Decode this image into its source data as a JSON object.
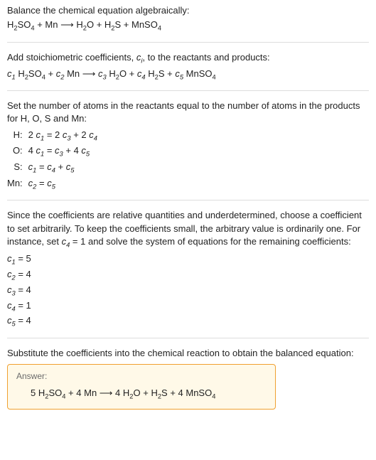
{
  "intro": {
    "line1": "Balance the chemical equation algebraically:"
  },
  "unbalanced": {
    "r1a": "H",
    "r1b": "2",
    "r1c": "SO",
    "r1d": "4",
    "plus1": " + ",
    "r2": "Mn",
    "arrow": " ⟶ ",
    "p1a": "H",
    "p1b": "2",
    "p1c": "O",
    "plus2": " + ",
    "p2a": "H",
    "p2b": "2",
    "p2c": "S",
    "plus3": " + ",
    "p3a": "MnSO",
    "p3b": "4"
  },
  "stoich_intro": {
    "t1": "Add stoichiometric coefficients, ",
    "ci_c": "c",
    "ci_i": "i",
    "t2": ", to the reactants and products:"
  },
  "stoich_eq": {
    "c1c": "c",
    "c1i": "1",
    "sp1": " ",
    "r1a": "H",
    "r1b": "2",
    "r1c": "SO",
    "r1d": "4",
    "plus1": " + ",
    "c2c": "c",
    "c2i": "2",
    "sp2": " ",
    "r2": "Mn",
    "arrow": " ⟶ ",
    "c3c": "c",
    "c3i": "3",
    "sp3": " ",
    "p1a": "H",
    "p1b": "2",
    "p1c": "O",
    "plus2": " + ",
    "c4c": "c",
    "c4i": "4",
    "sp4": " ",
    "p2a": "H",
    "p2b": "2",
    "p2c": "S",
    "plus3": " + ",
    "c5c": "c",
    "c5i": "5",
    "sp5": " ",
    "p3a": "MnSO",
    "p3b": "4"
  },
  "atoms_intro": "Set the number of atoms in the reactants equal to the number of atoms in the products for H, O, S and Mn:",
  "rows": {
    "H": {
      "lab": "H:",
      "l1": "2 ",
      "c1c": "c",
      "c1i": "1",
      "eq": " = 2 ",
      "c3c": "c",
      "c3i": "3",
      "pl": " + 2 ",
      "c4c": "c",
      "c4i": "4"
    },
    "O": {
      "lab": "O:",
      "l1": "4 ",
      "c1c": "c",
      "c1i": "1",
      "eq": " = ",
      "c3c": "c",
      "c3i": "3",
      "pl": " + 4 ",
      "c5c": "c",
      "c5i": "5"
    },
    "S": {
      "lab": "S:",
      "c1c": "c",
      "c1i": "1",
      "eq": " = ",
      "c4c": "c",
      "c4i": "4",
      "pl": " + ",
      "c5c": "c",
      "c5i": "5"
    },
    "Mn": {
      "lab": "Mn:",
      "c2c": "c",
      "c2i": "2",
      "eq": " = ",
      "c5c": "c",
      "c5i": "5"
    }
  },
  "choose": {
    "t1": "Since the coefficients are relative quantities and underdetermined, choose a coefficient to set arbitrarily. To keep the coefficients small, the arbitrary value is ordinarily one. For instance, set ",
    "cc": "c",
    "ci": "4",
    "t2": " = 1 and solve the system of equations for the remaining coefficients:"
  },
  "solved": {
    "c1": {
      "c": "c",
      "i": "1",
      "v": " = 5"
    },
    "c2": {
      "c": "c",
      "i": "2",
      "v": " = 4"
    },
    "c3": {
      "c": "c",
      "i": "3",
      "v": " = 4"
    },
    "c4": {
      "c": "c",
      "i": "4",
      "v": " = 1"
    },
    "c5": {
      "c": "c",
      "i": "5",
      "v": " = 4"
    }
  },
  "subst": "Substitute the coefficients into the chemical reaction to obtain the balanced equation:",
  "answer": {
    "hdr": "Answer:",
    "a1": "5 ",
    "r1a": "H",
    "r1b": "2",
    "r1c": "SO",
    "r1d": "4",
    "plus1": " + ",
    "a2": "4 ",
    "r2": "Mn",
    "arrow": " ⟶ ",
    "a3": "4 ",
    "p1a": "H",
    "p1b": "2",
    "p1c": "O",
    "plus2": " + ",
    "p2a": "H",
    "p2b": "2",
    "p2c": "S",
    "plus3": " + ",
    "a4": "4 ",
    "p3a": "MnSO",
    "p3b": "4"
  }
}
